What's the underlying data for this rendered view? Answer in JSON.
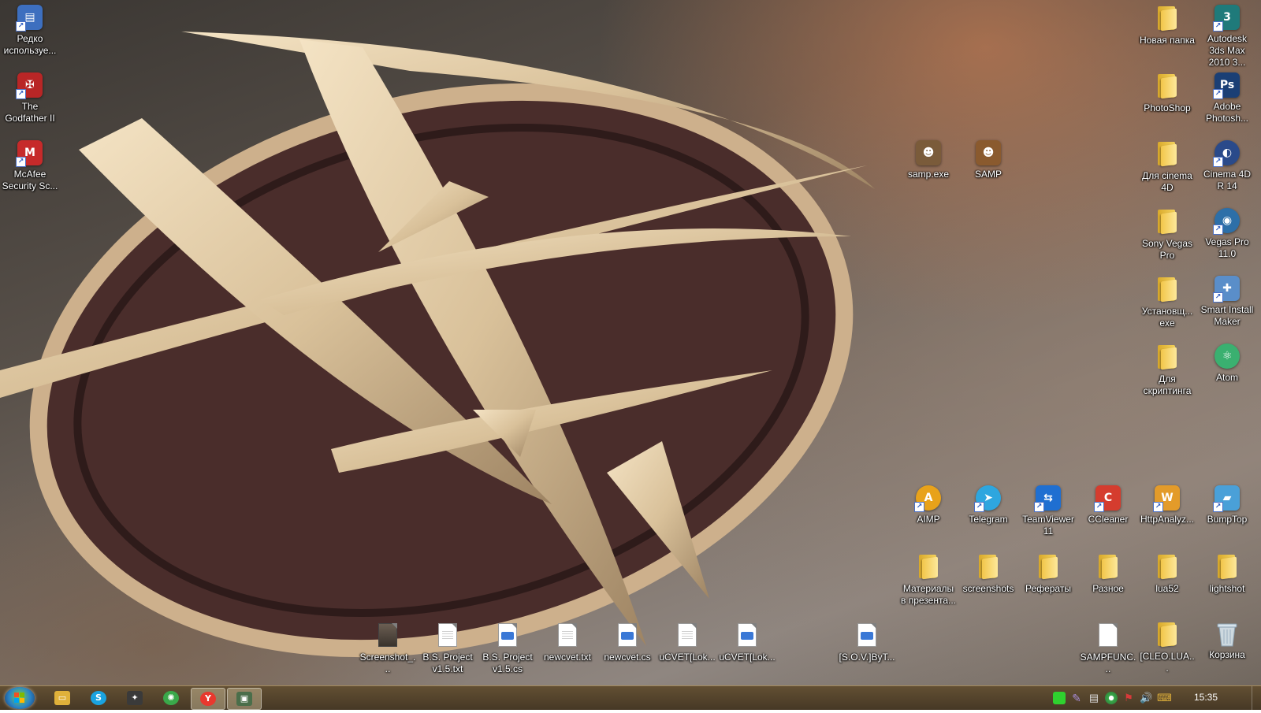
{
  "desktop": {
    "left_column": [
      {
        "label": "Редко используе...",
        "type": "app",
        "color": "#3d6fbf",
        "icon": "shortcut-folder-icon"
      },
      {
        "label": "The Godfather II",
        "type": "app",
        "color": "#b82626",
        "icon": "godfather-icon"
      },
      {
        "label": "McAfee Security Sc...",
        "type": "app",
        "color": "#c62a2a",
        "icon": "mcafee-icon"
      }
    ],
    "middle_icons": [
      {
        "label": "samp.exe",
        "type": "app",
        "color": "#7a5b3a",
        "icon": "samp-exe-icon"
      },
      {
        "label": "SAMP",
        "type": "app",
        "color": "#8a5a2e",
        "icon": "samp-icon"
      }
    ],
    "right_column_a": [
      {
        "label": "Новая папка",
        "type": "folder"
      },
      {
        "label": "PhotoShop",
        "type": "folder"
      },
      {
        "label": "Для cinema 4D",
        "type": "folder"
      },
      {
        "label": "Sony Vegas Pro",
        "type": "folder"
      },
      {
        "label": "Установщ... exe",
        "type": "folder"
      },
      {
        "label": "Для скриптинга",
        "type": "folder"
      }
    ],
    "right_column_b": [
      {
        "label": "Autodesk 3ds Max 2010 3...",
        "type": "app",
        "color": "#1f7a7a",
        "icon": "3dsmax-icon"
      },
      {
        "label": "Adobe Photosh...",
        "type": "app",
        "color": "#1b3f75",
        "icon": "photoshop-icon"
      },
      {
        "label": "Cinema 4D R 14",
        "type": "app",
        "color": "#2a4a8a",
        "icon": "cinema4d-icon"
      },
      {
        "label": "Vegas Pro 11.0",
        "type": "app",
        "color": "#2d6fa8",
        "icon": "vegas-icon"
      },
      {
        "label": "Smart Install Maker",
        "type": "app",
        "color": "#5a8ec9",
        "icon": "smart-install-icon"
      },
      {
        "label": "Atom",
        "type": "app",
        "color": "#3ab070",
        "icon": "atom-icon"
      }
    ],
    "row_apps": [
      {
        "label": "AIMP",
        "type": "app",
        "color": "#e8a21a",
        "icon": "aimp-icon"
      },
      {
        "label": "Telegram",
        "type": "app",
        "color": "#2ea6df",
        "icon": "telegram-icon"
      },
      {
        "label": "TeamViewer 11",
        "type": "app",
        "color": "#1f6fd1",
        "icon": "teamviewer-icon"
      },
      {
        "label": "CCleaner",
        "type": "app",
        "color": "#d53c2e",
        "icon": "ccleaner-icon"
      },
      {
        "label": "HttpAnalyz...",
        "type": "app",
        "color": "#e39b2a",
        "icon": "httpanalyzer-icon"
      },
      {
        "label": "BumpTop",
        "type": "app",
        "color": "#4aa0d8",
        "icon": "bumptop-icon"
      }
    ],
    "row_folders": [
      {
        "label": "Материалы в презента...",
        "type": "folder"
      },
      {
        "label": "screenshots",
        "type": "folder"
      },
      {
        "label": "Рефераты",
        "type": "folder"
      },
      {
        "label": "Разное",
        "type": "folder"
      },
      {
        "label": "lua52",
        "type": "folder"
      },
      {
        "label": "lightshot",
        "type": "folder"
      }
    ],
    "bottom_row": [
      {
        "label": "Screenshot_...",
        "type": "image"
      },
      {
        "label": "B.S. Project v1.5.txt",
        "type": "doc"
      },
      {
        "label": "B.S. Project v1.5.cs",
        "type": "code"
      },
      {
        "label": "newcvet.txt",
        "type": "doc"
      },
      {
        "label": "newcvet.cs",
        "type": "code"
      },
      {
        "label": "uCVET[Lok...",
        "type": "doc"
      },
      {
        "label": "uCVET[Lok...",
        "type": "code"
      },
      {
        "label": "[S.O.V.]ByT...",
        "type": "code"
      }
    ],
    "bottom_right": [
      {
        "label": "SAMPFUNC...",
        "type": "doc"
      },
      {
        "label": "[CLEO.LUA...",
        "type": "folder"
      },
      {
        "label": "Корзина",
        "type": "recycle"
      }
    ]
  },
  "taskbar": {
    "pinned": [
      {
        "name": "explorer",
        "color": "#e0b13a",
        "glyph": "▭"
      },
      {
        "name": "skype",
        "color": "#1aa3e0",
        "glyph": "S"
      },
      {
        "name": "samp",
        "color": "#3a3a3a",
        "glyph": "✦"
      },
      {
        "name": "webmoney",
        "color": "#3aa84a",
        "glyph": "✺"
      },
      {
        "name": "yandex",
        "color": "#e8382e",
        "glyph": "Y"
      },
      {
        "name": "screen",
        "color": "#4a6e4a",
        "glyph": "▣"
      }
    ],
    "tray": [
      {
        "name": "green-status",
        "color": "#2fd12f"
      },
      {
        "name": "pen",
        "color": "#a88cd8"
      },
      {
        "name": "network",
        "color": "#dddddd"
      },
      {
        "name": "chrome",
        "color": "#3aa84a"
      },
      {
        "name": "flag",
        "color": "#d83a3a"
      },
      {
        "name": "volume",
        "color": "#dddddd"
      },
      {
        "name": "keyboard-lang",
        "color": "#e0b13a"
      }
    ],
    "clock": "15:35"
  }
}
